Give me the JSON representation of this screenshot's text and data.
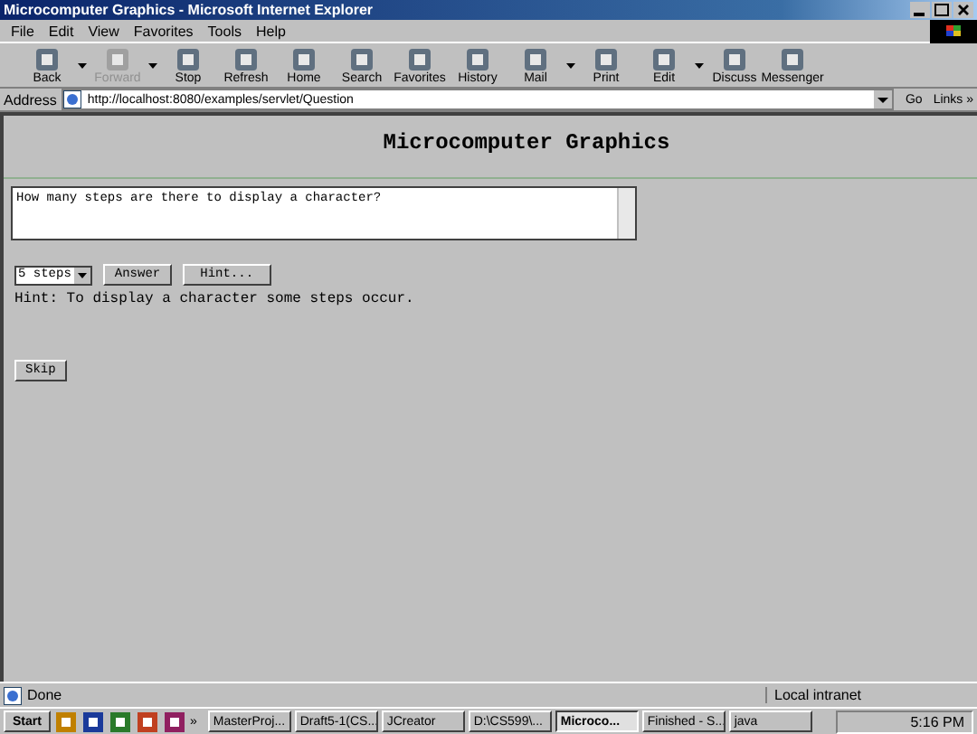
{
  "window": {
    "title": "Microcomputer Graphics - Microsoft Internet Explorer"
  },
  "menu": [
    "File",
    "Edit",
    "View",
    "Favorites",
    "Tools",
    "Help"
  ],
  "toolbar": [
    {
      "label": "Back",
      "disabled": false,
      "dropdown": true
    },
    {
      "label": "Forward",
      "disabled": true,
      "dropdown": true
    },
    {
      "label": "Stop",
      "disabled": false,
      "dropdown": false
    },
    {
      "label": "Refresh",
      "disabled": false,
      "dropdown": false
    },
    {
      "label": "Home",
      "disabled": false,
      "dropdown": false
    },
    {
      "label": "Search",
      "disabled": false,
      "dropdown": false
    },
    {
      "label": "Favorites",
      "disabled": false,
      "dropdown": false
    },
    {
      "label": "History",
      "disabled": false,
      "dropdown": false
    },
    {
      "label": "Mail",
      "disabled": false,
      "dropdown": true
    },
    {
      "label": "Print",
      "disabled": false,
      "dropdown": false
    },
    {
      "label": "Edit",
      "disabled": false,
      "dropdown": true
    },
    {
      "label": "Discuss",
      "disabled": false,
      "dropdown": false
    },
    {
      "label": "Messenger",
      "disabled": false,
      "dropdown": false
    }
  ],
  "address": {
    "label": "Address",
    "value": "http://localhost:8080/examples/servlet/Question",
    "go": "Go",
    "links": "Links",
    "more": "»"
  },
  "page": {
    "heading": "Microcomputer Graphics",
    "question": "How many steps are there to display a character?",
    "select": "5 steps",
    "answer_button": "Answer",
    "hint_button": "Hint...",
    "hint": "Hint: To display a character some steps occur.",
    "skip_button": "Skip"
  },
  "status_bar": {
    "text": "Done",
    "zone": "Local intranet"
  },
  "taskbar": {
    "start": "Start",
    "more": "»",
    "tasks": [
      {
        "label": "MasterProj...",
        "selected": false
      },
      {
        "label": "Draft5-1(CS...",
        "selected": false
      },
      {
        "label": "JCreator",
        "selected": false
      },
      {
        "label": "D:\\CS599\\...",
        "selected": false
      },
      {
        "label": "Microco...",
        "selected": true
      },
      {
        "label": "Finished - S...",
        "selected": false
      },
      {
        "label": "java",
        "selected": false
      }
    ],
    "clock": "5:16 PM"
  }
}
